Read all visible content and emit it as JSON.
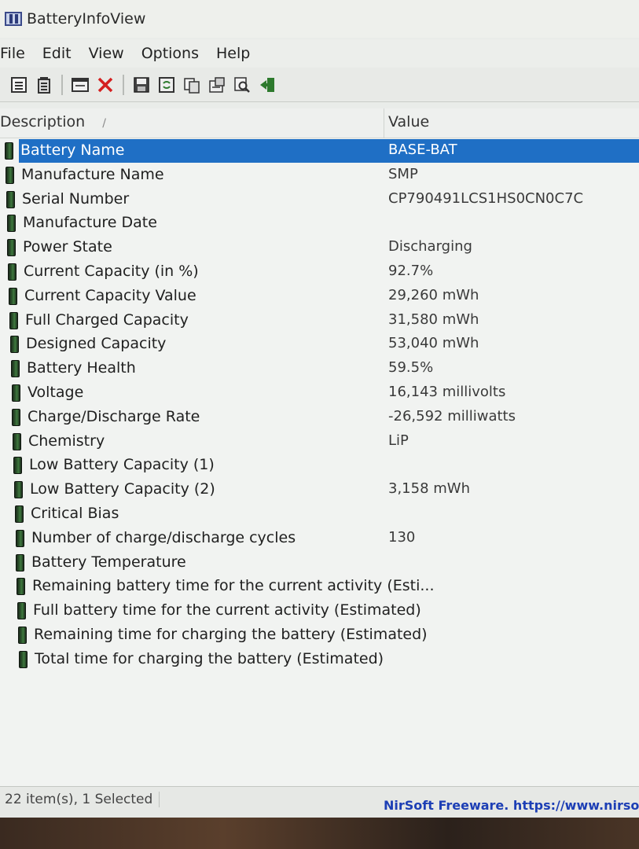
{
  "window": {
    "title": "BatteryInfoView"
  },
  "menu": [
    "File",
    "Edit",
    "View",
    "Options",
    "Help"
  ],
  "toolbar": {
    "icons": [
      "properties-icon",
      "battery-icon",
      "window-icon",
      "delete-icon",
      "save-icon",
      "refresh-icon",
      "copy-icon",
      "report-icon",
      "find-icon",
      "exit-icon"
    ]
  },
  "columns": {
    "description": "Description",
    "sort_indicator": "/",
    "value": "Value"
  },
  "rows": [
    {
      "desc": "Battery Name",
      "value": "BASE-BAT"
    },
    {
      "desc": "Manufacture Name",
      "value": "SMP"
    },
    {
      "desc": "Serial Number",
      "value": "CP790491LCS1HS0CN0C7C"
    },
    {
      "desc": "Manufacture Date",
      "value": ""
    },
    {
      "desc": "Power State",
      "value": "Discharging"
    },
    {
      "desc": "Current Capacity (in %)",
      "value": "92.7%"
    },
    {
      "desc": "Current Capacity Value",
      "value": "29,260 mWh"
    },
    {
      "desc": "Full Charged Capacity",
      "value": "31,580 mWh"
    },
    {
      "desc": "Designed Capacity",
      "value": "53,040 mWh"
    },
    {
      "desc": "Battery Health",
      "value": "59.5%"
    },
    {
      "desc": "Voltage",
      "value": "16,143 millivolts"
    },
    {
      "desc": "Charge/Discharge Rate",
      "value": "-26,592 milliwatts"
    },
    {
      "desc": "Chemistry",
      "value": "LiP"
    },
    {
      "desc": "Low Battery Capacity (1)",
      "value": ""
    },
    {
      "desc": "Low Battery Capacity (2)",
      "value": "3,158 mWh"
    },
    {
      "desc": "Critical Bias",
      "value": ""
    },
    {
      "desc": "Number of charge/discharge cycles",
      "value": "130"
    },
    {
      "desc": "Battery Temperature",
      "value": ""
    },
    {
      "desc": "Remaining battery time for the current activity (Esti...",
      "value": ""
    },
    {
      "desc": "Full battery time for the current activity (Estimated)",
      "value": ""
    },
    {
      "desc": "Remaining time for charging the battery (Estimated)",
      "value": ""
    },
    {
      "desc": "Total  time for charging the battery (Estimated)",
      "value": ""
    }
  ],
  "status": {
    "items": "22 item(s), 1 Selected",
    "credit": "NirSoft Freeware. https://www.nirsof"
  },
  "colors": {
    "selection": "#1f6fc5",
    "credit_link": "#1d3fb5"
  }
}
